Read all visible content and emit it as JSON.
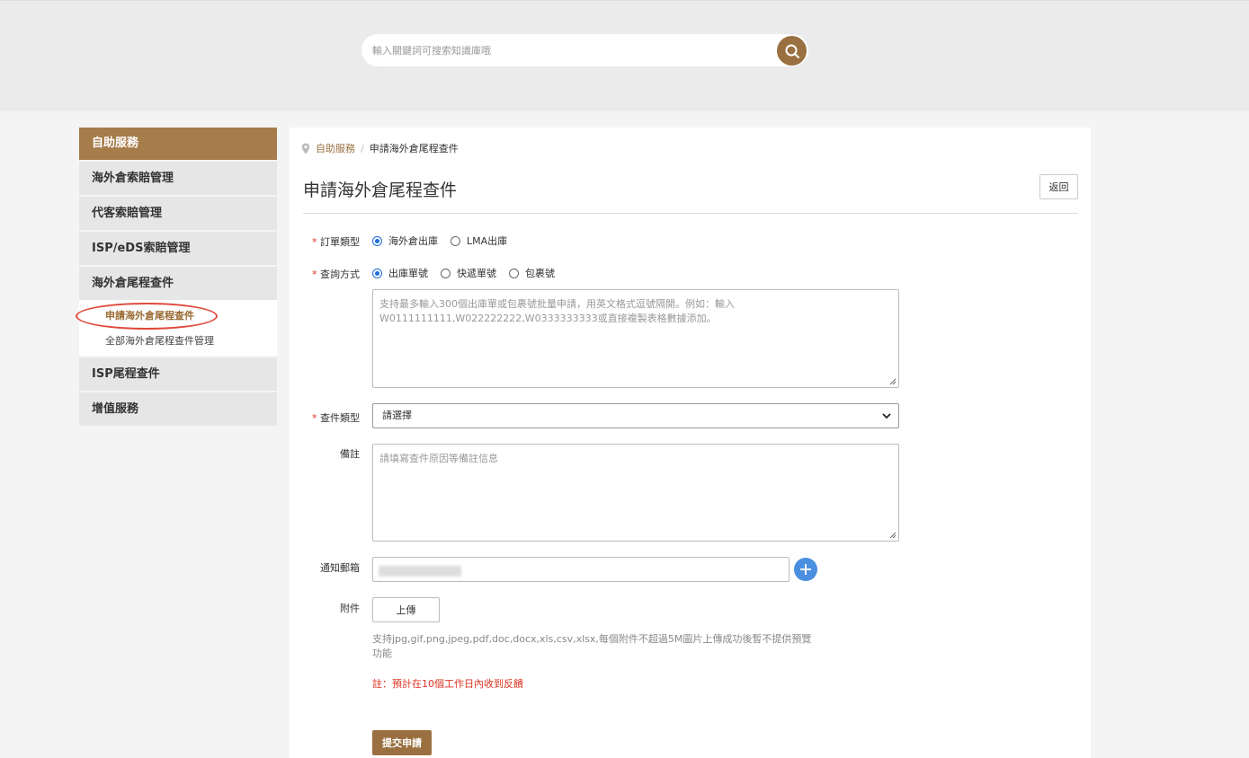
{
  "search": {
    "placeholder": "輸入關鍵詞可搜索知識庫哦",
    "icon": "search-icon"
  },
  "colors": {
    "accent": "#9a7040",
    "sidebar_header": "#a67c4a",
    "required": "#dd3322",
    "add_button": "#4a8fe0"
  },
  "sidebar": {
    "header": "自助服務",
    "items": [
      {
        "label": "海外倉索賠管理"
      },
      {
        "label": "代客索賠管理"
      },
      {
        "label": "ISP/eDS索賠管理"
      },
      {
        "label": "海外倉尾程查件"
      }
    ],
    "sub_items": [
      {
        "label": "申請海外倉尾程查件",
        "active": true
      },
      {
        "label": "全部海外倉尾程查件管理",
        "active": false
      }
    ],
    "items_after": [
      {
        "label": "ISP尾程查件"
      },
      {
        "label": "增值服務"
      }
    ]
  },
  "breadcrumb": {
    "parent": "自助服務",
    "separator": "/",
    "current": "申請海外倉尾程查件"
  },
  "page": {
    "title": "申請海外倉尾程查件",
    "back_label": "返回"
  },
  "form": {
    "order_type": {
      "required_mark": "*",
      "label": "訂單類型",
      "options": [
        "海外倉出庫",
        "LMA出庫"
      ],
      "selected": "海外倉出庫"
    },
    "query_method": {
      "required_mark": "*",
      "label": "查詢方式",
      "options": [
        "出庫單號",
        "快遞單號",
        "包裹號"
      ],
      "selected": "出庫單號",
      "placeholder": "支持最多輸入300個出庫單或包裹號批量申請，用英文格式逗號隔開。例如：輸入W0111111111,W022222222,W0333333333或直接複製表格數據添加。"
    },
    "inquiry_type": {
      "required_mark": "*",
      "label": "查件類型",
      "selected": "請選擇"
    },
    "remarks": {
      "label": "備註",
      "placeholder": "請填寫查件原因等備註信息"
    },
    "email": {
      "label": "通知郵箱",
      "add_icon": "plus-icon"
    },
    "attachment": {
      "label": "附件",
      "upload_label": "上傳",
      "hint": "支持jpg,gif,png,jpeg,pdf,doc,docx,xls,csv,xlsx,每個附件不超過5M圖片上傳成功後暫不提供預覽功能"
    },
    "note": "註：預計在10個工作日內收到反饋",
    "submit_label": "提交申請"
  }
}
